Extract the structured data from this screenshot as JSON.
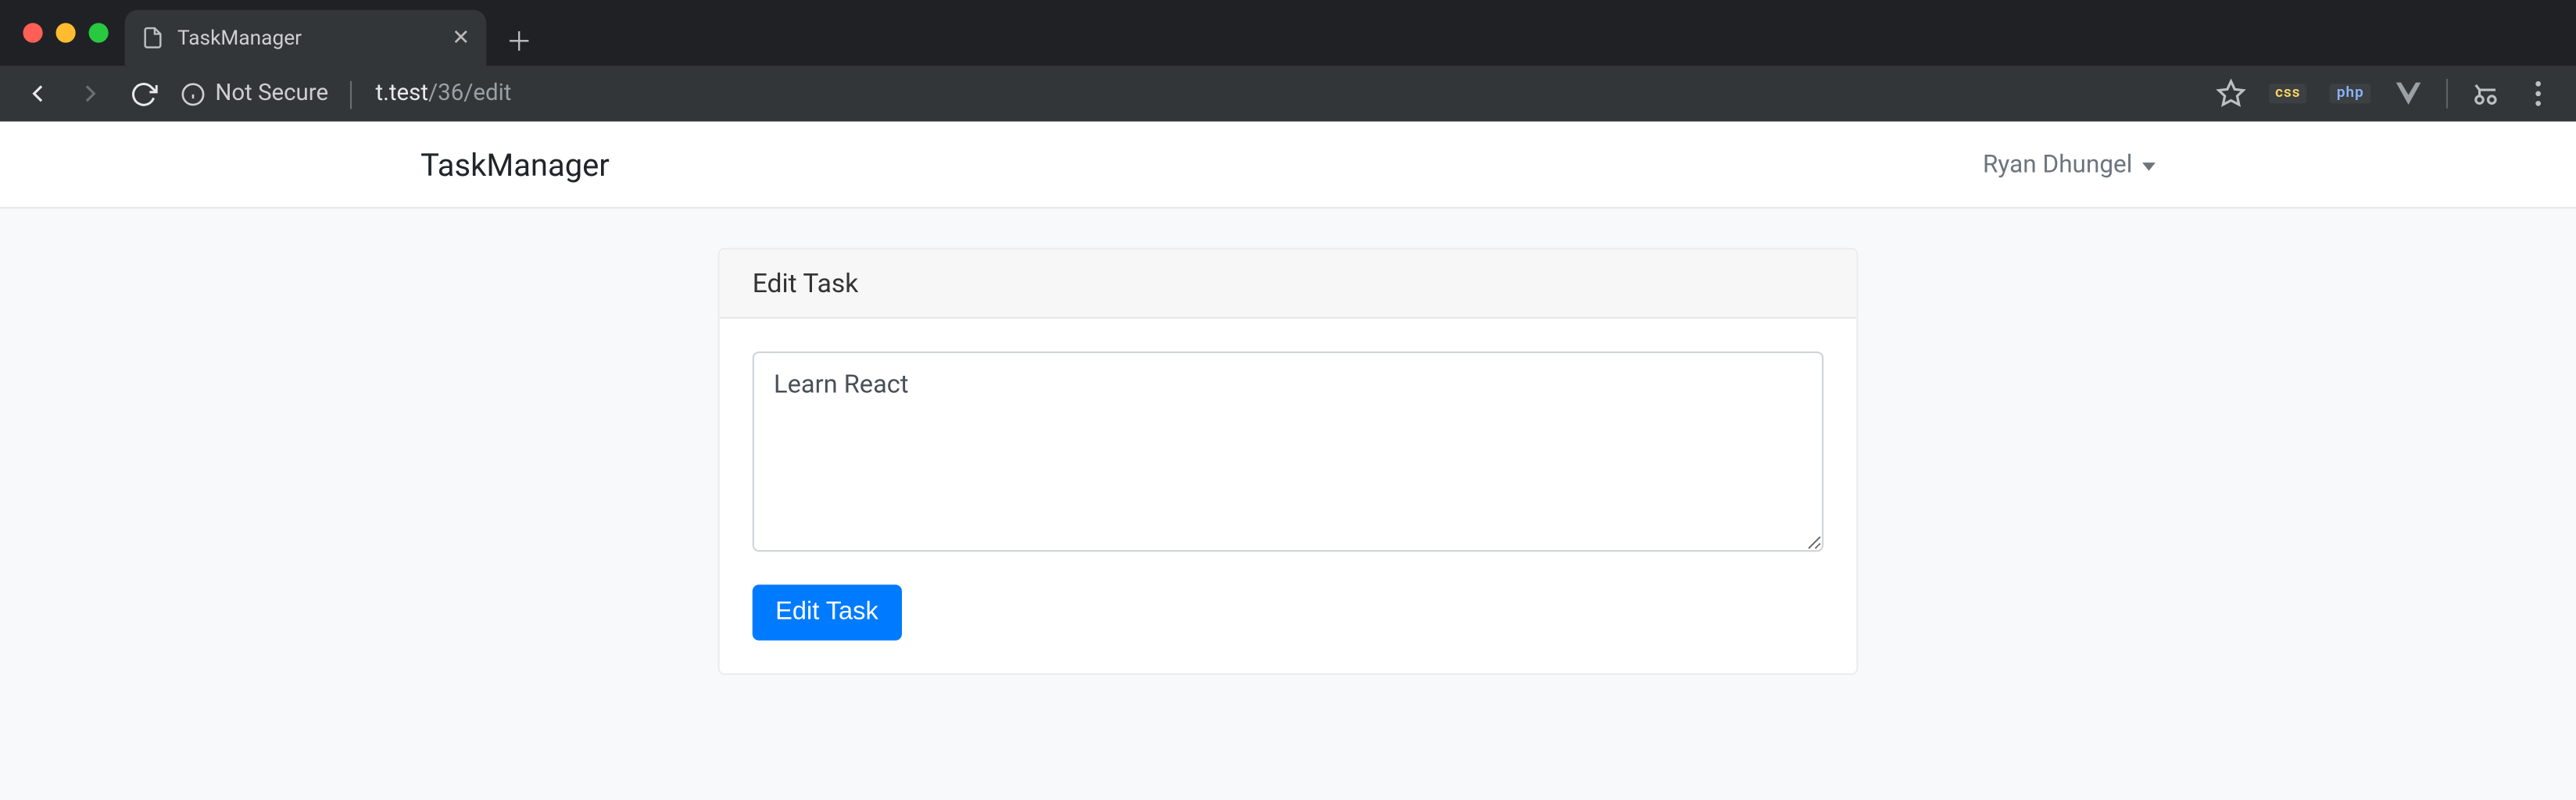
{
  "browser": {
    "tab_title": "TaskManager",
    "not_secure_label": "Not Secure",
    "url_host": "t.test",
    "url_path": "/36/edit",
    "extension_labels": {
      "css": "css",
      "php": "php"
    }
  },
  "navbar": {
    "brand": "TaskManager",
    "user_name": "Ryan Dhungel"
  },
  "card": {
    "header": "Edit Task",
    "task_value": "Learn React",
    "submit_label": "Edit Task"
  }
}
